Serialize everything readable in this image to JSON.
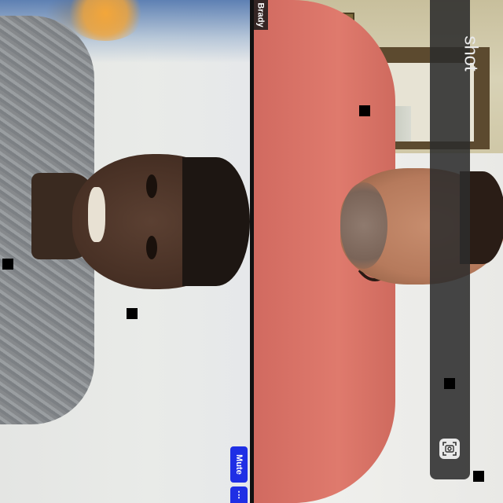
{
  "participants": [
    {
      "name": "",
      "position": "left"
    },
    {
      "name": "Brady",
      "position": "right"
    }
  ],
  "screenshot_panel": {
    "title": "shot",
    "capture_icon": "camera-shutter-icon"
  },
  "controls": {
    "mute_label": "Mute",
    "more_label": "⋮"
  },
  "colors": {
    "mute_button": "#1f2fe5",
    "panel_bg": "#2c2c2c"
  }
}
